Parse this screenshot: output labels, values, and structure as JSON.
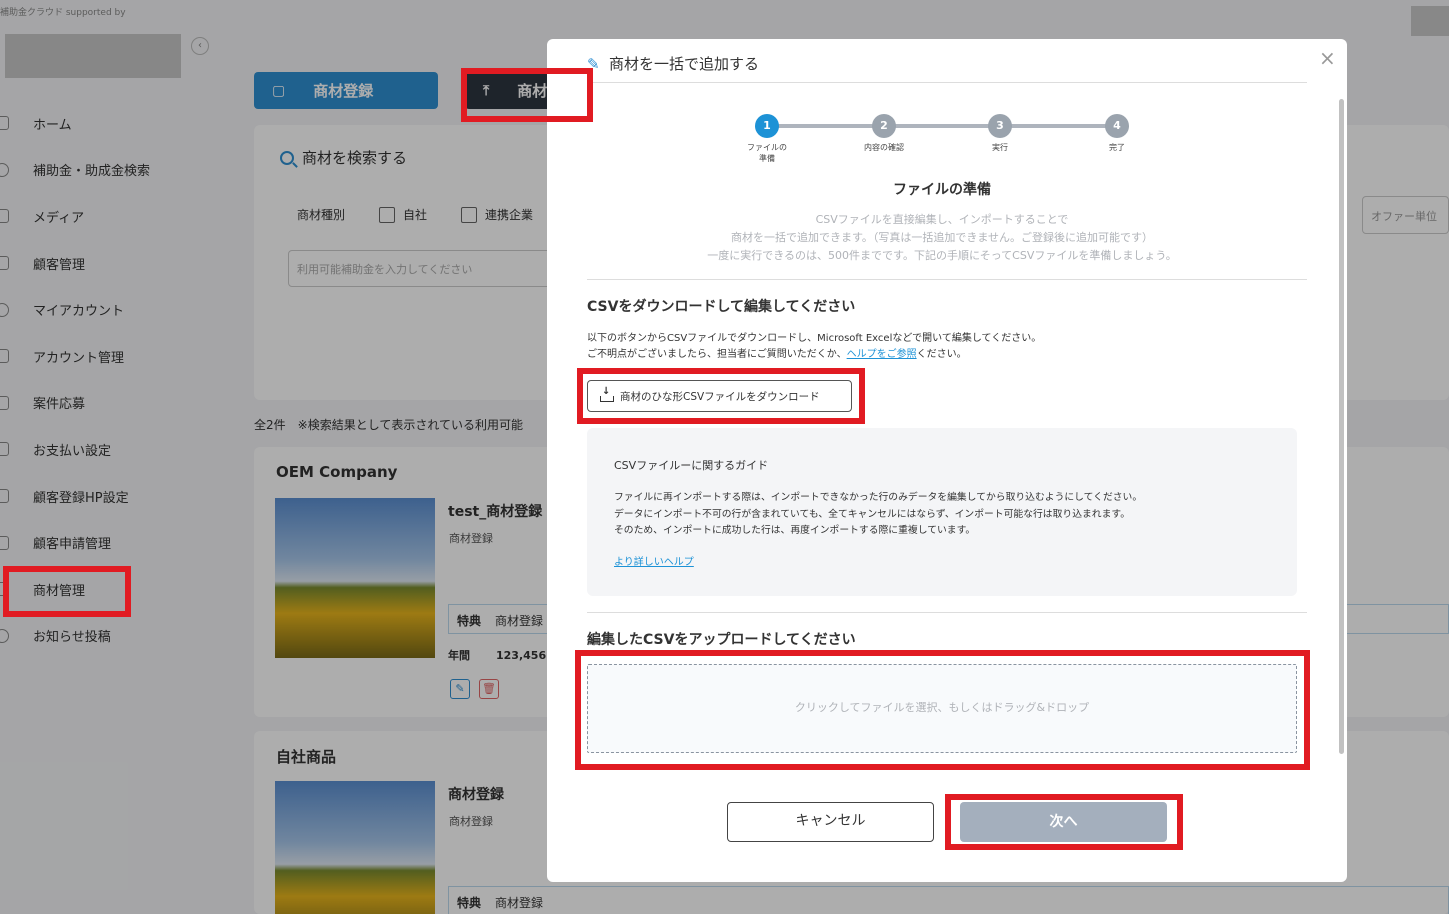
{
  "background": {
    "brand_text": "補助金クラウド supported by",
    "sidebar": {
      "items": [
        {
          "label": "ホーム",
          "icon": "home-icon"
        },
        {
          "label": "補助金・助成金検索",
          "icon": "search-icon"
        },
        {
          "label": "メディア",
          "icon": "media-icon"
        },
        {
          "label": "顧客管理",
          "icon": "customer-icon"
        },
        {
          "label": "マイアカウント",
          "icon": "account-icon"
        },
        {
          "label": "アカウント管理",
          "icon": "account-manage-icon"
        },
        {
          "label": "案件応募",
          "icon": "apply-icon"
        },
        {
          "label": "お支払い設定",
          "icon": "payment-icon"
        },
        {
          "label": "顧客登録HP設定",
          "icon": "registration-icon"
        },
        {
          "label": "顧客申請管理",
          "icon": "application-icon"
        },
        {
          "label": "商材管理",
          "icon": "product-icon"
        },
        {
          "label": "お知らせ投稿",
          "icon": "notice-icon"
        }
      ]
    },
    "tabs": {
      "register": "商材登録",
      "bulk": "商材一"
    },
    "search": {
      "title": "商材を検索する",
      "kind_label": "商材種別",
      "opt_self": "自社",
      "opt_partner": "連携企業",
      "subsidy_placeholder": "利用可能補助金を入力してください",
      "offer_placeholder": "オファー単位"
    },
    "result_count": "全2件　※検索結果として表示されている利用可能",
    "cards": [
      {
        "company": "OEM Company",
        "name": "test_商材登録",
        "sub": "商材登録",
        "benefit_label": "特典",
        "benefit_value": "商材登録",
        "annual_label": "年間",
        "annual_value": "123,456"
      },
      {
        "company": "自社商品",
        "name": "商材登録",
        "sub": "商材登録",
        "benefit_label": "特典",
        "benefit_value": "商材登録"
      }
    ]
  },
  "modal": {
    "title": "商材を一括で追加する",
    "steps": [
      {
        "num": "1",
        "label": "ファイルの準備"
      },
      {
        "num": "2",
        "label": "内容の確認"
      },
      {
        "num": "3",
        "label": "実行"
      },
      {
        "num": "4",
        "label": "完了"
      }
    ],
    "section_title": "ファイルの準備",
    "intro_lines": [
      "CSVファイルを直接編集し、インポートすることで",
      "商材を一括で追加できます。（写真は一括追加できません。ご登録後に追加可能です）",
      "一度に実行できるのは、500件までです。下記の手順にそってCSVファイルを準備しましょう。"
    ],
    "download_heading": "CSVをダウンロードして編集してください",
    "download_desc_1": "以下のボタンからCSVファイルでダウンロードし、Microsoft Excelなどで開いて編集してください。",
    "download_desc_2a": "ご不明点がございましたら、担当者にご質問いただくか、",
    "download_desc_link": "ヘルプをご参照",
    "download_desc_2b": "ください。",
    "download_button": "商材のひな形CSVファイルをダウンロード",
    "guide": {
      "title": "CSVファイルーに関するガイド",
      "lines": [
        "ファイルに再インポートする際は、インポートできなかった行のみデータを編集してから取り込むようにしてください。",
        "データにインポート不可の行が含まれていても、全てキャンセルにはならず、インポート可能な行は取り込まれます。",
        "そのため、インポートに成功した行は、再度インポートする際に重複しています。"
      ],
      "link": "より詳しいヘルプ"
    },
    "upload_heading": "編集したCSVをアップロードしてください",
    "dropzone_text": "クリックしてファイルを選択、もしくはドラッグ&ドロップ",
    "cancel_button": "キャンセル",
    "next_button": "次へ"
  },
  "colors": {
    "accent": "#1d92d6",
    "annotation": "#e11b22",
    "disabled_button": "#a4afbd"
  }
}
